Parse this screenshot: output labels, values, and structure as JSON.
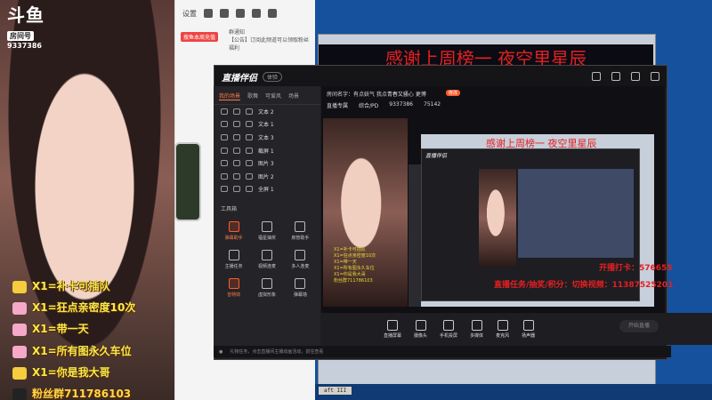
{
  "cam": {
    "logo_main": "斗鱼",
    "logo_sub": "房间号",
    "room_id": "9337386",
    "danmu": [
      {
        "text": "X1=补卡可插队",
        "color": "#f5cc3d"
      },
      {
        "text": "X1=狂点亲密度10次",
        "color": "#f5a8c8"
      },
      {
        "text": "X1=带一天",
        "color": "#f5a8c8"
      },
      {
        "text": "X1=所有图永久车位",
        "color": "#f5a8c8"
      },
      {
        "text": "X1=你是我大哥",
        "color": "#f5cc3d"
      }
    ],
    "fans_group": "粉丝群711786103"
  },
  "chat": {
    "settings_label": "设置",
    "red_tag": "搜鱼本周充值",
    "notice_title": "群通知",
    "notice_text": "【公告】订阅此频道可以领取粉丝福利"
  },
  "banner": {
    "text": "感谢上周榜一 夜空里星辰"
  },
  "app": {
    "brand": "直播伴侣",
    "badge": "体验",
    "tabs": [
      "我的场景",
      "歌舞",
      "可爱风",
      "场景"
    ],
    "layers": [
      "文本 2",
      "文本 1",
      "文本 3",
      "截屏 1",
      "图片 3",
      "图片 2",
      "全屏 1"
    ],
    "toolbox_title": "工具箱",
    "tools": [
      "弹幕助手",
      "福星抽奖",
      "房管助手",
      "主播任务",
      "视频连麦",
      "多人连麦",
      "音特效",
      "虚拟形象",
      "弹幕墙"
    ],
    "room_name_label": "房间名字：有点妖气 我点青春又骚心 更博",
    "room_tag": "修改",
    "room_meta": [
      "直播专属",
      "综合/PD",
      "9337386",
      "75142"
    ],
    "bottom_tools": [
      "直播屏幕",
      "摄像头",
      "手机投屏",
      "多媒体",
      "麦克风",
      "扬声器"
    ],
    "start_button": "开始直播",
    "status_text": "礼物任务，点击直播间主播动画活动，前往查看"
  },
  "preview": {
    "inner_brand": "直播伴侣",
    "inner_banner": "感谢上周榜一 夜空里星辰",
    "danmu_small": [
      "X1=补卡可插队",
      "X1=狂点亲密度10次",
      "X1=带一天",
      "X1=所有图永久车位",
      "X1=你是我大哥",
      "粉丝群711786103"
    ]
  },
  "overlays": {
    "line1": "开播打卡：576655",
    "line2": "直播任务/抽奖/积分：切换视频：11387525201"
  },
  "taskbar": {
    "label": "aft III"
  },
  "colors": {
    "accent": "#ff5a2a",
    "banner_red": "#e42020",
    "danmu_yellow": "#f4ea4f",
    "desktop_blue": "#15519c"
  }
}
